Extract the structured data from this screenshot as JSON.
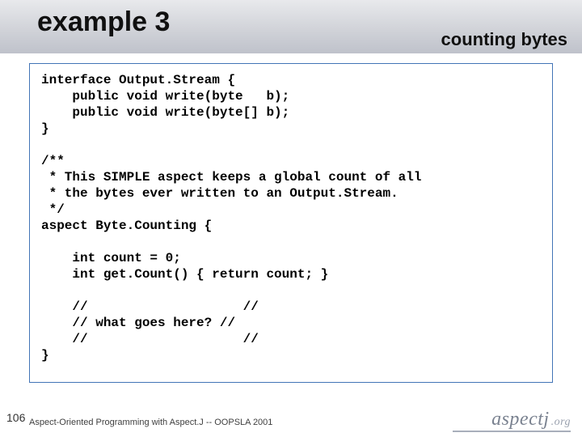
{
  "title": "example 3",
  "subtitle": "counting bytes",
  "code": "interface Output.Stream {\n    public void write(byte   b);\n    public void write(byte[] b);\n}\n\n/**\n * This SIMPLE aspect keeps a global count of all\n * the bytes ever written to an Output.Stream.\n */\naspect Byte.Counting {\n\n    int count = 0;\n    int get.Count() { return count; }\n\n    //                    //\n    // what goes here? //\n    //                    //\n}",
  "page_number": "106",
  "footer": "Aspect-Oriented Programming with Aspect.J -- OOPSLA 2001",
  "logo_main": "aspectj",
  "logo_suffix": ".org"
}
